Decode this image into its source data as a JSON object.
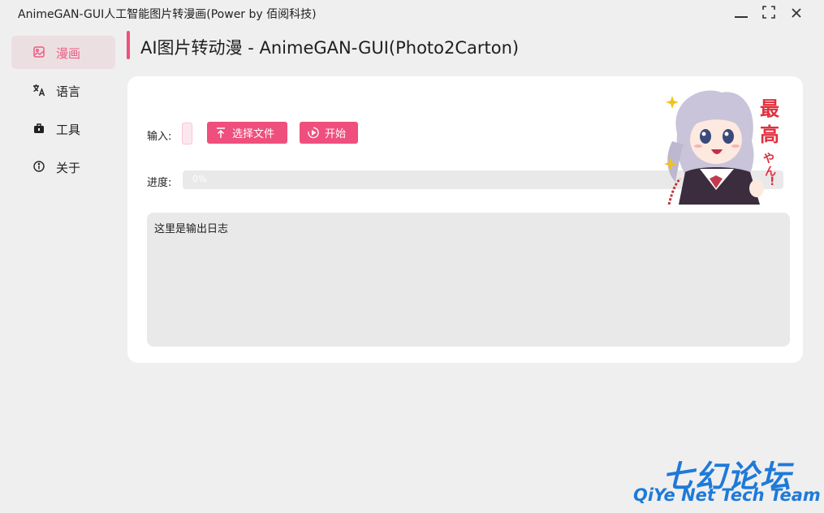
{
  "window": {
    "title": "AnimeGAN-GUI人工智能图片转漫画(Power by 佰阅科技)",
    "minimize_icon": "minimize-icon",
    "maximize_icon": "maximize-icon",
    "close_icon": "close-icon"
  },
  "sidebar": {
    "items": [
      {
        "label": "漫画",
        "icon": "image-icon",
        "active": true
      },
      {
        "label": "语言",
        "icon": "translate-icon",
        "active": false
      },
      {
        "label": "工具",
        "icon": "toolbox-icon",
        "active": false
      },
      {
        "label": "关于",
        "icon": "info-icon",
        "active": false
      }
    ]
  },
  "page": {
    "title": "AI图片转动漫 - AnimeGAN-GUI(Photo2Carton)"
  },
  "form": {
    "input_label": "输入:",
    "choose_file_label": "选择文件",
    "start_label": "开始",
    "progress_label": "进度:",
    "progress_text": "0%",
    "progress_value": 0,
    "log_placeholder": "这里是输出日志"
  },
  "sticker": {
    "text": "最高やん!"
  },
  "watermark": {
    "cn": "七幻论坛",
    "en": "QiYe Net Tech Team"
  },
  "colors": {
    "accent": "#ef4f7c",
    "watermark": "#1e7ad8"
  }
}
